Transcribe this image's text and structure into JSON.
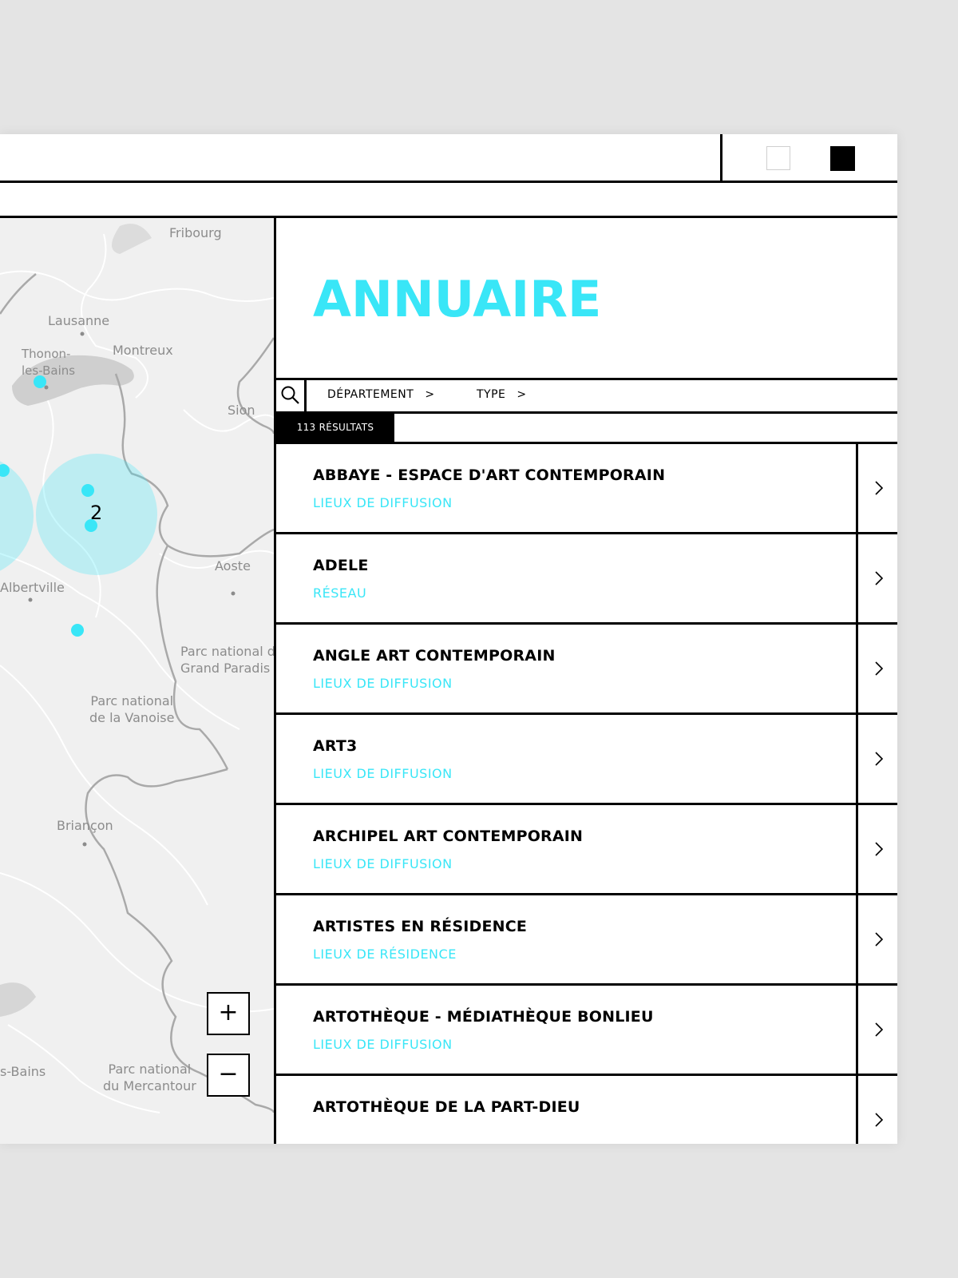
{
  "window": {
    "view_buttons": [
      {
        "name": "light-mode",
        "color": "#ffffff"
      },
      {
        "name": "dark-mode",
        "color": "#000000"
      }
    ]
  },
  "map": {
    "labels": [
      {
        "name": "fribourg",
        "text": "Fribourg"
      },
      {
        "name": "lausanne",
        "text": "Lausanne"
      },
      {
        "name": "thonon",
        "text": "Thonon-\nles-Bains"
      },
      {
        "name": "montreux",
        "text": "Montreux"
      },
      {
        "name": "sion",
        "text": "Sion"
      },
      {
        "name": "aoste",
        "text": "Aoste"
      },
      {
        "name": "albertville",
        "text": "Albertville"
      },
      {
        "name": "grand-paradis",
        "text": "Parc national du\nGrand Paradis"
      },
      {
        "name": "vanoise",
        "text": "Parc national\nde la Vanoise"
      },
      {
        "name": "briancon",
        "text": "Briançon"
      },
      {
        "name": "mercantour",
        "text": "Parc national\ndu Mercantour"
      },
      {
        "name": "les-bains",
        "text": "s-Bains"
      }
    ],
    "cluster_count": "2",
    "zoom_in": "+",
    "zoom_out": "−",
    "marker_color": "#39e6f7"
  },
  "directory": {
    "title": "ANNUAIRE",
    "accent_color": "#39e6f7",
    "filters": [
      {
        "label": "DÉPARTEMENT",
        "chevron": ">"
      },
      {
        "label": "TYPE",
        "chevron": ">"
      }
    ],
    "results_count": "113 RÉSULTATS",
    "items": [
      {
        "name": "ABBAYE - ESPACE D'ART CONTEMPORAIN",
        "type": "LIEUX DE DIFFUSION"
      },
      {
        "name": "ADELE",
        "type": "RÉSEAU"
      },
      {
        "name": "ANGLE ART CONTEMPORAIN",
        "type": "LIEUX DE DIFFUSION"
      },
      {
        "name": "ART3",
        "type": "LIEUX DE DIFFUSION"
      },
      {
        "name": "ARCHIPEL ART CONTEMPORAIN",
        "type": "LIEUX DE DIFFUSION"
      },
      {
        "name": "ARTISTES EN RÉSIDENCE",
        "type": "LIEUX DE RÉSIDENCE"
      },
      {
        "name": "ARTOTHÈQUE - MÉDIATHÈQUE BONLIEU",
        "type": "LIEUX DE DIFFUSION"
      },
      {
        "name": "ARTOTHÈQUE DE LA PART-DIEU",
        "type": ""
      }
    ]
  }
}
